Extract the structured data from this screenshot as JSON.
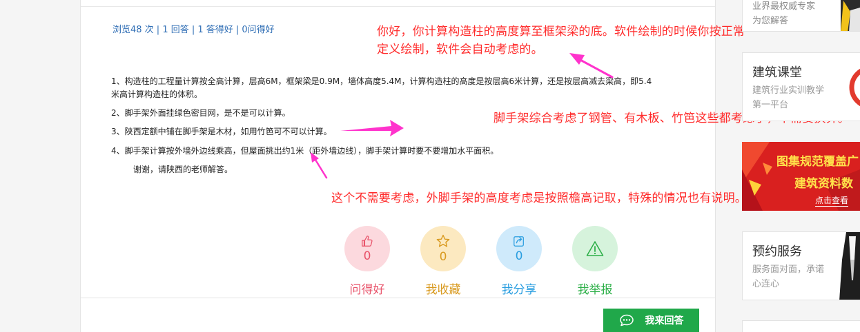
{
  "stats": {
    "text": "浏览48 次 | 1 回答 | 1 答得好 | 0问得好"
  },
  "question": {
    "line1a": "1、构造柱的工程量计算按全高计算，层高6M，框架梁是0.9M，墙体高度5.4M，计算构造柱的高度是按层高6米计算，还是按层高减去梁高，即5.4",
    "line1b": "米高计算构造柱的体积。",
    "line2": "2、脚手架外面挂绿色密目网，是不是可以计算。",
    "line3": "3、陕西定额中铺在脚手架是木材，如用竹笆可不可以计算。",
    "line4": "4、脚手架计算按外墙外边线乘高，但屋面挑出约1米（距外墙边线），脚手架计算时要不要增加水平面积。",
    "line5": "谢谢，请陕西的老师解答。"
  },
  "annotations": {
    "a1_line1": "你好，你计算构造柱的高度算至框架梁的底。软件绘制的时候你按正常",
    "a1_line2": "定义绘制，软件会自动考虑的。",
    "a2": "脚手架综合考虑了钢管、有木板、竹笆这些都考虑了，不需要换算。",
    "a3": "这个不需要考虑，外脚手架的高度考虑是按照檐高记取，特殊的情况也有说明。",
    "color": "#ff2b2b",
    "arrow_color": "#ff33cc"
  },
  "actions": [
    {
      "icon": "thumbs-up-icon",
      "count": "0",
      "label": "问得好",
      "color": "#e8536a"
    },
    {
      "icon": "star-icon",
      "count": "0",
      "label": "我收藏",
      "color": "#d99a1f"
    },
    {
      "icon": "share-icon",
      "count": "0",
      "label": "我分享",
      "color": "#2a9ee0"
    },
    {
      "icon": "warning-icon",
      "count": "",
      "label": "我举报",
      "color": "#2fb04a"
    }
  ],
  "answer_button": {
    "label": "我来回答",
    "color": "#20a84a",
    "icon": "chat-icon"
  },
  "sidebar": {
    "top_card": {
      "line1": "业界最权威专家",
      "line2": "为您解答"
    },
    "course": {
      "title": "建筑课堂",
      "desc": "建筑行业实训教学第一平台"
    },
    "banner": {
      "line1": "图集规范覆盖广",
      "line2": "建筑资料数",
      "link": "点击查看"
    },
    "service": {
      "title": "预约服务",
      "desc": "服务面对面，承诺心连心"
    }
  }
}
